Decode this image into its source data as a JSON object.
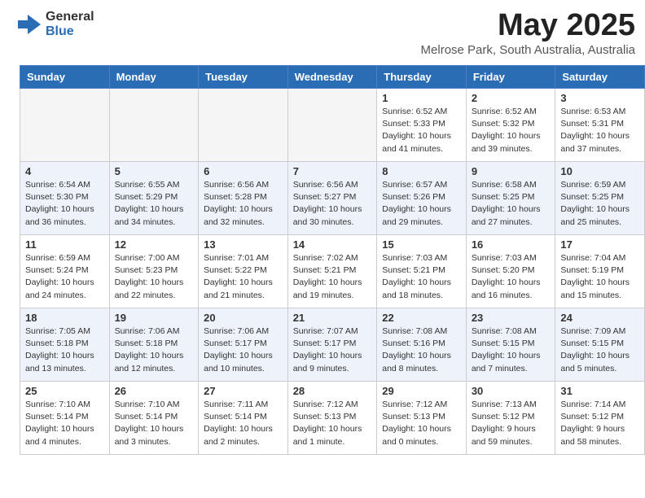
{
  "header": {
    "logo_general": "General",
    "logo_blue": "Blue",
    "month_year": "May 2025",
    "location": "Melrose Park, South Australia, Australia"
  },
  "days_of_week": [
    "Sunday",
    "Monday",
    "Tuesday",
    "Wednesday",
    "Thursday",
    "Friday",
    "Saturday"
  ],
  "weeks": [
    [
      {
        "day": "",
        "empty": true
      },
      {
        "day": "",
        "empty": true
      },
      {
        "day": "",
        "empty": true
      },
      {
        "day": "",
        "empty": true
      },
      {
        "day": "1",
        "sunrise": "6:52 AM",
        "sunset": "5:33 PM",
        "daylight": "10 hours and 41 minutes."
      },
      {
        "day": "2",
        "sunrise": "6:52 AM",
        "sunset": "5:32 PM",
        "daylight": "10 hours and 39 minutes."
      },
      {
        "day": "3",
        "sunrise": "6:53 AM",
        "sunset": "5:31 PM",
        "daylight": "10 hours and 37 minutes."
      }
    ],
    [
      {
        "day": "4",
        "sunrise": "6:54 AM",
        "sunset": "5:30 PM",
        "daylight": "10 hours and 36 minutes."
      },
      {
        "day": "5",
        "sunrise": "6:55 AM",
        "sunset": "5:29 PM",
        "daylight": "10 hours and 34 minutes."
      },
      {
        "day": "6",
        "sunrise": "6:56 AM",
        "sunset": "5:28 PM",
        "daylight": "10 hours and 32 minutes."
      },
      {
        "day": "7",
        "sunrise": "6:56 AM",
        "sunset": "5:27 PM",
        "daylight": "10 hours and 30 minutes."
      },
      {
        "day": "8",
        "sunrise": "6:57 AM",
        "sunset": "5:26 PM",
        "daylight": "10 hours and 29 minutes."
      },
      {
        "day": "9",
        "sunrise": "6:58 AM",
        "sunset": "5:25 PM",
        "daylight": "10 hours and 27 minutes."
      },
      {
        "day": "10",
        "sunrise": "6:59 AM",
        "sunset": "5:25 PM",
        "daylight": "10 hours and 25 minutes."
      }
    ],
    [
      {
        "day": "11",
        "sunrise": "6:59 AM",
        "sunset": "5:24 PM",
        "daylight": "10 hours and 24 minutes."
      },
      {
        "day": "12",
        "sunrise": "7:00 AM",
        "sunset": "5:23 PM",
        "daylight": "10 hours and 22 minutes."
      },
      {
        "day": "13",
        "sunrise": "7:01 AM",
        "sunset": "5:22 PM",
        "daylight": "10 hours and 21 minutes."
      },
      {
        "day": "14",
        "sunrise": "7:02 AM",
        "sunset": "5:21 PM",
        "daylight": "10 hours and 19 minutes."
      },
      {
        "day": "15",
        "sunrise": "7:03 AM",
        "sunset": "5:21 PM",
        "daylight": "10 hours and 18 minutes."
      },
      {
        "day": "16",
        "sunrise": "7:03 AM",
        "sunset": "5:20 PM",
        "daylight": "10 hours and 16 minutes."
      },
      {
        "day": "17",
        "sunrise": "7:04 AM",
        "sunset": "5:19 PM",
        "daylight": "10 hours and 15 minutes."
      }
    ],
    [
      {
        "day": "18",
        "sunrise": "7:05 AM",
        "sunset": "5:18 PM",
        "daylight": "10 hours and 13 minutes."
      },
      {
        "day": "19",
        "sunrise": "7:06 AM",
        "sunset": "5:18 PM",
        "daylight": "10 hours and 12 minutes."
      },
      {
        "day": "20",
        "sunrise": "7:06 AM",
        "sunset": "5:17 PM",
        "daylight": "10 hours and 10 minutes."
      },
      {
        "day": "21",
        "sunrise": "7:07 AM",
        "sunset": "5:17 PM",
        "daylight": "10 hours and 9 minutes."
      },
      {
        "day": "22",
        "sunrise": "7:08 AM",
        "sunset": "5:16 PM",
        "daylight": "10 hours and 8 minutes."
      },
      {
        "day": "23",
        "sunrise": "7:08 AM",
        "sunset": "5:15 PM",
        "daylight": "10 hours and 7 minutes."
      },
      {
        "day": "24",
        "sunrise": "7:09 AM",
        "sunset": "5:15 PM",
        "daylight": "10 hours and 5 minutes."
      }
    ],
    [
      {
        "day": "25",
        "sunrise": "7:10 AM",
        "sunset": "5:14 PM",
        "daylight": "10 hours and 4 minutes."
      },
      {
        "day": "26",
        "sunrise": "7:10 AM",
        "sunset": "5:14 PM",
        "daylight": "10 hours and 3 minutes."
      },
      {
        "day": "27",
        "sunrise": "7:11 AM",
        "sunset": "5:14 PM",
        "daylight": "10 hours and 2 minutes."
      },
      {
        "day": "28",
        "sunrise": "7:12 AM",
        "sunset": "5:13 PM",
        "daylight": "10 hours and 1 minute."
      },
      {
        "day": "29",
        "sunrise": "7:12 AM",
        "sunset": "5:13 PM",
        "daylight": "10 hours and 0 minutes."
      },
      {
        "day": "30",
        "sunrise": "7:13 AM",
        "sunset": "5:12 PM",
        "daylight": "9 hours and 59 minutes."
      },
      {
        "day": "31",
        "sunrise": "7:14 AM",
        "sunset": "5:12 PM",
        "daylight": "9 hours and 58 minutes."
      }
    ]
  ]
}
